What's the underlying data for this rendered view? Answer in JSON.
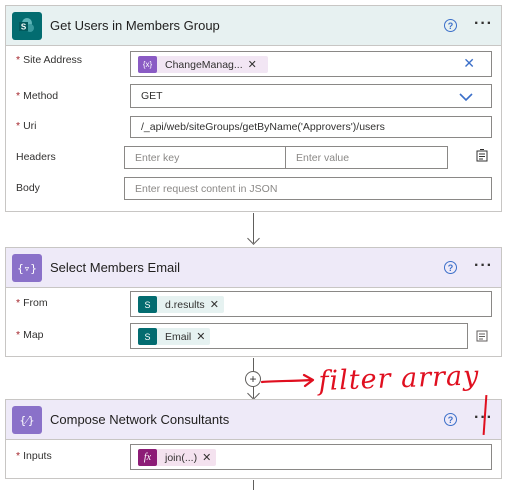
{
  "colors": {
    "sharepoint": "#036c70",
    "data_op": "#8a71c9",
    "compose_expr": "#8c1c76",
    "annotation": "#e00f1f"
  },
  "card1": {
    "title": "Get Users in Members Group",
    "icon": "sharepoint-icon",
    "site_address": {
      "label": "Site Address",
      "token": "ChangeManag...",
      "token_icon": "variable-icon"
    },
    "method": {
      "label": "Method",
      "value": "GET"
    },
    "uri": {
      "label": "Uri",
      "value": "/_api/web/siteGroups/getByName('Approvers')/users"
    },
    "headers": {
      "label": "Headers",
      "key_placeholder": "Enter key",
      "value_placeholder": "Enter value"
    },
    "body": {
      "label": "Body",
      "placeholder": "Enter request content in JSON"
    }
  },
  "card2": {
    "title": "Select Members Email",
    "icon": "data-operation-icon",
    "from": {
      "label": "From",
      "token": "d.results"
    },
    "map": {
      "label": "Map",
      "token": "Email"
    }
  },
  "card3": {
    "title": "Compose Network Consultants",
    "icon": "compose-icon",
    "inputs": {
      "label": "Inputs",
      "token": "join(...)",
      "token_icon_label": "fx"
    }
  },
  "annotation": {
    "text": "filter array"
  }
}
